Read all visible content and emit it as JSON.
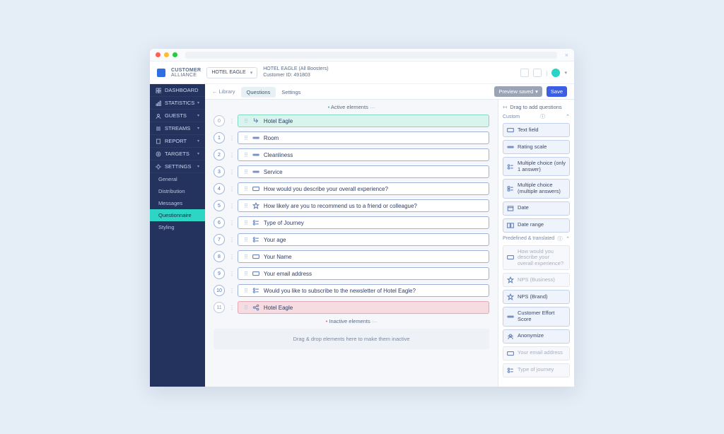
{
  "brand": {
    "line1": "CUSTOMER",
    "line2": "ALLIANCE"
  },
  "tenant": {
    "selector_label": "HOTEL EAGLE",
    "title": "HOTEL EAGLE (All Boosters)",
    "subtitle": "Customer ID: 491803"
  },
  "sidebar": {
    "items": [
      {
        "label": "DASHBOARD",
        "icon": "dashboard"
      },
      {
        "label": "STATISTICS",
        "icon": "stats"
      },
      {
        "label": "GUESTS",
        "icon": "guests"
      },
      {
        "label": "STREAMS",
        "icon": "streams"
      },
      {
        "label": "REPORT",
        "icon": "report"
      },
      {
        "label": "TARGETS",
        "icon": "targets"
      },
      {
        "label": "SETTINGS",
        "icon": "settings"
      }
    ],
    "settings_subitems": [
      {
        "label": "General"
      },
      {
        "label": "Distribution"
      },
      {
        "label": "Messages"
      },
      {
        "label": "Questionnaire",
        "active": true
      },
      {
        "label": "Styling"
      }
    ]
  },
  "tabs": {
    "back": "← Library",
    "items": [
      {
        "label": "Questions",
        "active": true
      },
      {
        "label": "Settings"
      }
    ],
    "preview_btn": "Preview saved",
    "save_btn": "Save"
  },
  "active_section": "Active elements",
  "inactive_section": "Inactive elements",
  "drop_hint": "Drag & drop elements here to make them inactive",
  "questions": [
    {
      "n": "0",
      "kind": "start",
      "icon": "enter",
      "label": "Hotel Eagle"
    },
    {
      "n": "1",
      "kind": "",
      "icon": "scale",
      "label": "Room"
    },
    {
      "n": "2",
      "kind": "",
      "icon": "scale",
      "label": "Cleanliness"
    },
    {
      "n": "3",
      "kind": "",
      "icon": "scale",
      "label": "Service"
    },
    {
      "n": "4",
      "kind": "",
      "icon": "text",
      "label": "How would you describe your overall experience?"
    },
    {
      "n": "5",
      "kind": "",
      "icon": "nps",
      "label": "How likely are you to recommend us to a friend or colleague?"
    },
    {
      "n": "6",
      "kind": "",
      "icon": "single",
      "label": "Type of Journey"
    },
    {
      "n": "7",
      "kind": "",
      "icon": "single",
      "label": "Your age"
    },
    {
      "n": "8",
      "kind": "",
      "icon": "text",
      "label": "Your Name"
    },
    {
      "n": "9",
      "kind": "",
      "icon": "text",
      "label": "Your email address"
    },
    {
      "n": "10",
      "kind": "",
      "icon": "single",
      "label": "Would you like to subscribe to the newsletter of Hotel Eagle?"
    },
    {
      "n": "11",
      "kind": "end",
      "icon": "share",
      "label": "Hotel Eagle"
    }
  ],
  "right": {
    "heading": "Drag to add questions",
    "group_custom": "Custom",
    "group_predef": "Predefined & translated",
    "custom_blocks": [
      {
        "icon": "text",
        "label": "Text field"
      },
      {
        "icon": "scale",
        "label": "Rating scale"
      },
      {
        "icon": "single",
        "label": "Multiple choice (only 1 answer)"
      },
      {
        "icon": "multi",
        "label": "Multiple choice (multiple answers)"
      },
      {
        "icon": "date",
        "label": "Date"
      },
      {
        "icon": "daterng",
        "label": "Date range"
      }
    ],
    "predef_blocks": [
      {
        "icon": "text",
        "label": "How would you describe your overall experience?",
        "disabled": true
      },
      {
        "icon": "nps",
        "label": "NPS (Business)",
        "disabled": true
      },
      {
        "icon": "nps",
        "label": "NPS (Brand)"
      },
      {
        "icon": "scale",
        "label": "Customer Effort Score"
      },
      {
        "icon": "anon",
        "label": "Anonymize"
      },
      {
        "icon": "text",
        "label": "Your email address",
        "disabled": true
      },
      {
        "icon": "single",
        "label": "Type of journey",
        "disabled": true
      }
    ]
  }
}
